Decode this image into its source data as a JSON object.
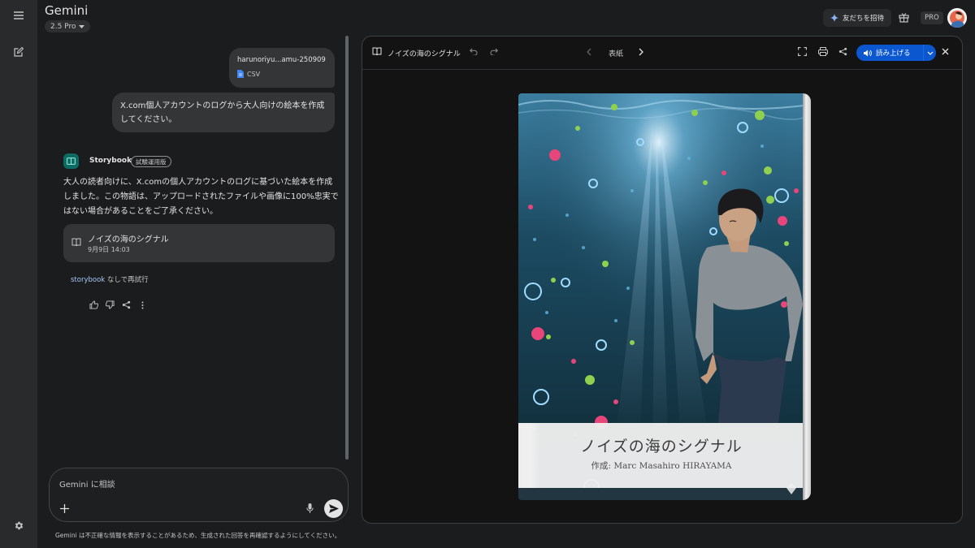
{
  "app": {
    "title": "Gemini",
    "model": "2.5 Pro"
  },
  "header": {
    "invite_label": "友だちを招待",
    "pro_label": "PRO"
  },
  "chat": {
    "attachment": {
      "name": "harunoriyu...amu-250909",
      "type": "CSV"
    },
    "user_message": "X.com個人アカウントのログから大人向けの絵本を作成してください。",
    "agent": {
      "name": "Storybook",
      "badge": "試験運用版"
    },
    "response_text": "大人の読者向けに、X.comの個人アカウントのログに基づいた絵本を作成しました。この物語は、アップロードされたファイルや画像に100%忠実ではない場合があることをご了承ください。",
    "story_card": {
      "title": "ノイズの海のシグナル",
      "date": "9月9日 14:03"
    },
    "retry": {
      "highlight": "storybook",
      "rest": " なしで再試行"
    }
  },
  "input": {
    "placeholder": "Gemini に相談"
  },
  "disclaimer": "Gemini は不正確な情報を表示することがあるため、生成された回答を再確認するようにしてください。",
  "canvas": {
    "title": "ノイズの海のシグナル",
    "page_label": "表紙",
    "read_aloud": "読み上げる",
    "cover": {
      "title": "ノイズの海のシグナル",
      "author": "作成: Marc Masahiro HIRAYAMA"
    }
  },
  "icons": {
    "rail": [
      "menu-icon",
      "new-chat-icon",
      "settings-icon"
    ],
    "message_actions": [
      "thumb-up-icon",
      "thumb-down-icon",
      "share-icon",
      "more-vert-icon"
    ]
  },
  "colors": {
    "background": "#1b1c1d",
    "rail": "#282a2c",
    "bubble": "#333537",
    "accent": "#0b57d0",
    "link": "#a8c7fa",
    "storybook_icon": "#0d6b63"
  }
}
